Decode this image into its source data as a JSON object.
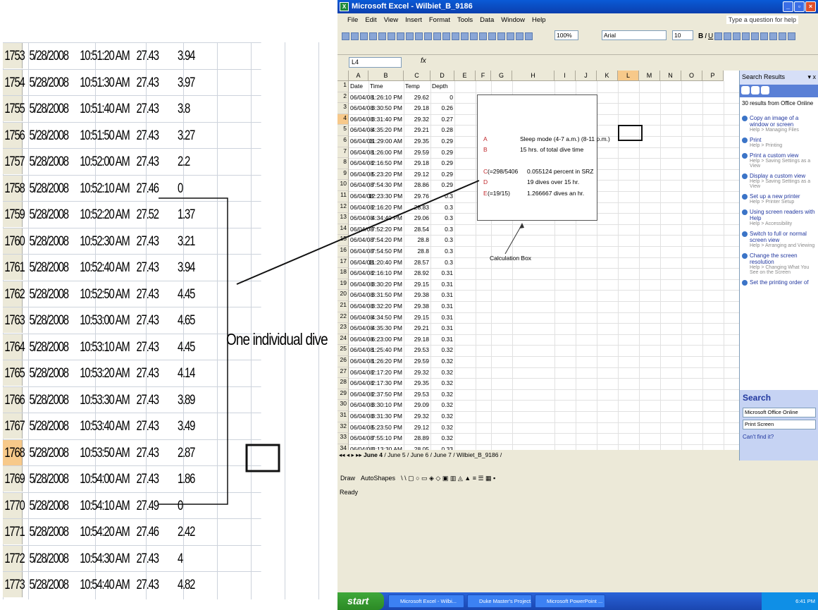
{
  "zoom": {
    "rows": [
      {
        "n": "1753",
        "date": "5/28/2008",
        "time": "10:51:20 AM",
        "temp": "27.43",
        "depth": "3.94"
      },
      {
        "n": "1754",
        "date": "5/28/2008",
        "time": "10:51:30 AM",
        "temp": "27.43",
        "depth": "3.97"
      },
      {
        "n": "1755",
        "date": "5/28/2008",
        "time": "10:51:40 AM",
        "temp": "27.43",
        "depth": "3.8"
      },
      {
        "n": "1756",
        "date": "5/28/2008",
        "time": "10:51:50 AM",
        "temp": "27.43",
        "depth": "3.27"
      },
      {
        "n": "1757",
        "date": "5/28/2008",
        "time": "10:52:00 AM",
        "temp": "27.43",
        "depth": "2.2"
      },
      {
        "n": "1758",
        "date": "5/28/2008",
        "time": "10:52:10 AM",
        "temp": "27.46",
        "depth": "0"
      },
      {
        "n": "1759",
        "date": "5/28/2008",
        "time": "10:52:20 AM",
        "temp": "27.52",
        "depth": "1.37"
      },
      {
        "n": "1760",
        "date": "5/28/2008",
        "time": "10:52:30 AM",
        "temp": "27.43",
        "depth": "3.21"
      },
      {
        "n": "1761",
        "date": "5/28/2008",
        "time": "10:52:40 AM",
        "temp": "27.43",
        "depth": "3.94"
      },
      {
        "n": "1762",
        "date": "5/28/2008",
        "time": "10:52:50 AM",
        "temp": "27.43",
        "depth": "4.45"
      },
      {
        "n": "1763",
        "date": "5/28/2008",
        "time": "10:53:00 AM",
        "temp": "27.43",
        "depth": "4.65"
      },
      {
        "n": "1764",
        "date": "5/28/2008",
        "time": "10:53:10 AM",
        "temp": "27.43",
        "depth": "4.45"
      },
      {
        "n": "1765",
        "date": "5/28/2008",
        "time": "10:53:20 AM",
        "temp": "27.43",
        "depth": "4.14"
      },
      {
        "n": "1766",
        "date": "5/28/2008",
        "time": "10:53:30 AM",
        "temp": "27.43",
        "depth": "3.89"
      },
      {
        "n": "1767",
        "date": "5/28/2008",
        "time": "10:53:40 AM",
        "temp": "27.43",
        "depth": "3.49"
      },
      {
        "n": "1768",
        "date": "5/28/2008",
        "time": "10:53:50 AM",
        "temp": "27.43",
        "depth": "2.87"
      },
      {
        "n": "1769",
        "date": "5/28/2008",
        "time": "10:54:00 AM",
        "temp": "27.43",
        "depth": "1.86"
      },
      {
        "n": "1770",
        "date": "5/28/2008",
        "time": "10:54:10 AM",
        "temp": "27.49",
        "depth": "0"
      },
      {
        "n": "1771",
        "date": "5/28/2008",
        "time": "10:54:20 AM",
        "temp": "27.46",
        "depth": "2.42"
      },
      {
        "n": "1772",
        "date": "5/28/2008",
        "time": "10:54:30 AM",
        "temp": "27.43",
        "depth": "4"
      },
      {
        "n": "1773",
        "date": "5/28/2008",
        "time": "10:54:40 AM",
        "temp": "27.43",
        "depth": "4.82"
      }
    ],
    "selected_row": "1768",
    "label": "One individual dive"
  },
  "excel": {
    "title": "Microsoft Excel - Wilbiet_B_9186",
    "menu": [
      "File",
      "Edit",
      "View",
      "Insert",
      "Format",
      "Tools",
      "Data",
      "Window",
      "Help"
    ],
    "help_box": "Type a question for help",
    "zoom_level": "100%",
    "font_name": "Arial",
    "font_size": "10",
    "name_box": "L4",
    "fx": "fx",
    "columns": [
      "A",
      "B",
      "C",
      "D",
      "E",
      "F",
      "G",
      "H",
      "I",
      "J",
      "K",
      "L",
      "M",
      "N",
      "O",
      "P"
    ],
    "selected_column": "L",
    "header_row": [
      "Date",
      "Time",
      "Temp",
      "Depth"
    ],
    "rows": [
      [
        "06/04/08",
        "1:26:10 PM",
        "29.62",
        "0"
      ],
      [
        "06/04/08",
        "3:30:50 PM",
        "29.18",
        "0.26"
      ],
      [
        "06/04/08",
        "3:31:40 PM",
        "29.32",
        "0.27"
      ],
      [
        "06/04/08",
        "4:35:20 PM",
        "29.21",
        "0.28"
      ],
      [
        "06/04/08",
        "11:29:00 AM",
        "29.35",
        "0.29"
      ],
      [
        "06/04/08",
        "1:26:00 PM",
        "29.59",
        "0.29"
      ],
      [
        "06/04/08",
        "2:16:50 PM",
        "29.18",
        "0.29"
      ],
      [
        "06/04/08",
        "5:23:20 PM",
        "29.12",
        "0.29"
      ],
      [
        "06/04/08",
        "7:54:30 PM",
        "28.86",
        "0.29"
      ],
      [
        "06/04/08",
        "12:23:30 PM",
        "29.76",
        "0.3"
      ],
      [
        "06/04/08",
        "2:16:20 PM",
        "28.83",
        "0.3"
      ],
      [
        "06/04/08",
        "4:34:40 PM",
        "29.06",
        "0.3"
      ],
      [
        "06/04/08",
        "7:52:20 PM",
        "28.54",
        "0.3"
      ],
      [
        "06/04/08",
        "7:54:20 PM",
        "28.8",
        "0.3"
      ],
      [
        "06/04/08",
        "7:54:50 PM",
        "28.8",
        "0.3"
      ],
      [
        "06/04/08",
        "11:20:40 PM",
        "28.57",
        "0.3"
      ],
      [
        "06/04/08",
        "2:16:10 PM",
        "28.92",
        "0.31"
      ],
      [
        "06/04/08",
        "3:30:20 PM",
        "29.15",
        "0.31"
      ],
      [
        "06/04/08",
        "3:31:50 PM",
        "29.38",
        "0.31"
      ],
      [
        "06/04/08",
        "3:32:20 PM",
        "29.38",
        "0.31"
      ],
      [
        "06/04/08",
        "4:34:50 PM",
        "29.15",
        "0.31"
      ],
      [
        "06/04/08",
        "4:35:30 PM",
        "29.21",
        "0.31"
      ],
      [
        "06/04/08",
        "6:23:00 PM",
        "29.18",
        "0.31"
      ],
      [
        "06/04/08",
        "1:25:40 PM",
        "29.53",
        "0.32"
      ],
      [
        "06/04/08",
        "1:26:20 PM",
        "29.59",
        "0.32"
      ],
      [
        "06/04/08",
        "2:17:20 PM",
        "29.32",
        "0.32"
      ],
      [
        "06/04/08",
        "2:17:30 PM",
        "29.35",
        "0.32"
      ],
      [
        "06/04/08",
        "2:37:50 PM",
        "29.53",
        "0.32"
      ],
      [
        "06/04/08",
        "3:30:10 PM",
        "29.09",
        "0.32"
      ],
      [
        "06/04/08",
        "3:31:30 PM",
        "29.32",
        "0.32"
      ],
      [
        "06/04/08",
        "5:23:50 PM",
        "29.12",
        "0.32"
      ],
      [
        "06/04/08",
        "7:55:10 PM",
        "28.89",
        "0.32"
      ],
      [
        "06/04/08",
        "3:13:30 AM",
        "28.05",
        "0.33"
      ],
      [
        "06/04/08",
        "10:56:00 AM",
        "29.24",
        "0.33"
      ]
    ],
    "calc": {
      "a_letter": "A",
      "a_text": "Sleep mode (4-7 a.m.) (8-11 p.m.)",
      "b_letter": "B",
      "b_text": "15 hrs. of total dive time",
      "c_letter": "C",
      "c_formula": "(=298/5406",
      "c_text": "0.055124 percent in SRZ",
      "d_letter": "D",
      "d_text": "19 dives over 15 hr.",
      "e_letter": "E",
      "e_formula": "(=19/15)",
      "e_text": "1.266667 dives an hr.",
      "caption": "Calculation Box"
    },
    "sheet_tabs": [
      "June 4",
      "June 5",
      "June 6",
      "June 7",
      "Wilbiet_B_9186"
    ],
    "active_tab": "June 4",
    "draw_label": "Draw",
    "autoshapes_label": "AutoShapes",
    "status": "Ready",
    "pane": {
      "title": "Search Results",
      "count": "30 results from Office Online",
      "results": [
        {
          "title": "Copy an image of a window or screen",
          "sub": "Help > Managing Files"
        },
        {
          "title": "Print",
          "sub": "Help > Printing"
        },
        {
          "title": "Print a custom view",
          "sub": "Help > Saving Settings as a View"
        },
        {
          "title": "Display a custom view",
          "sub": "Help > Saving Settings as a View"
        },
        {
          "title": "Set up a new printer",
          "sub": "Help > Printer Setup"
        },
        {
          "title": "Using screen readers with Help",
          "sub": "Help > Accessibility"
        },
        {
          "title": "Switch to full or normal screen view",
          "sub": "Help > Arranging and Viewing"
        },
        {
          "title": "Change the screen resolution",
          "sub": "Help > Changing What You See on the Screen"
        },
        {
          "title": "Set the printing order of",
          "sub": ""
        }
      ],
      "search_title": "Search",
      "search_scope": "Microsoft Office Online",
      "search_value": "Print Screen",
      "cant_find": "Can't find it?"
    }
  },
  "taskbar": {
    "start": "start",
    "tasks": [
      "Microsoft Excel - Wilbi...",
      "Duke Master's Project...",
      "Microsoft PowerPoint ..."
    ],
    "clock": "6:41 PM"
  }
}
